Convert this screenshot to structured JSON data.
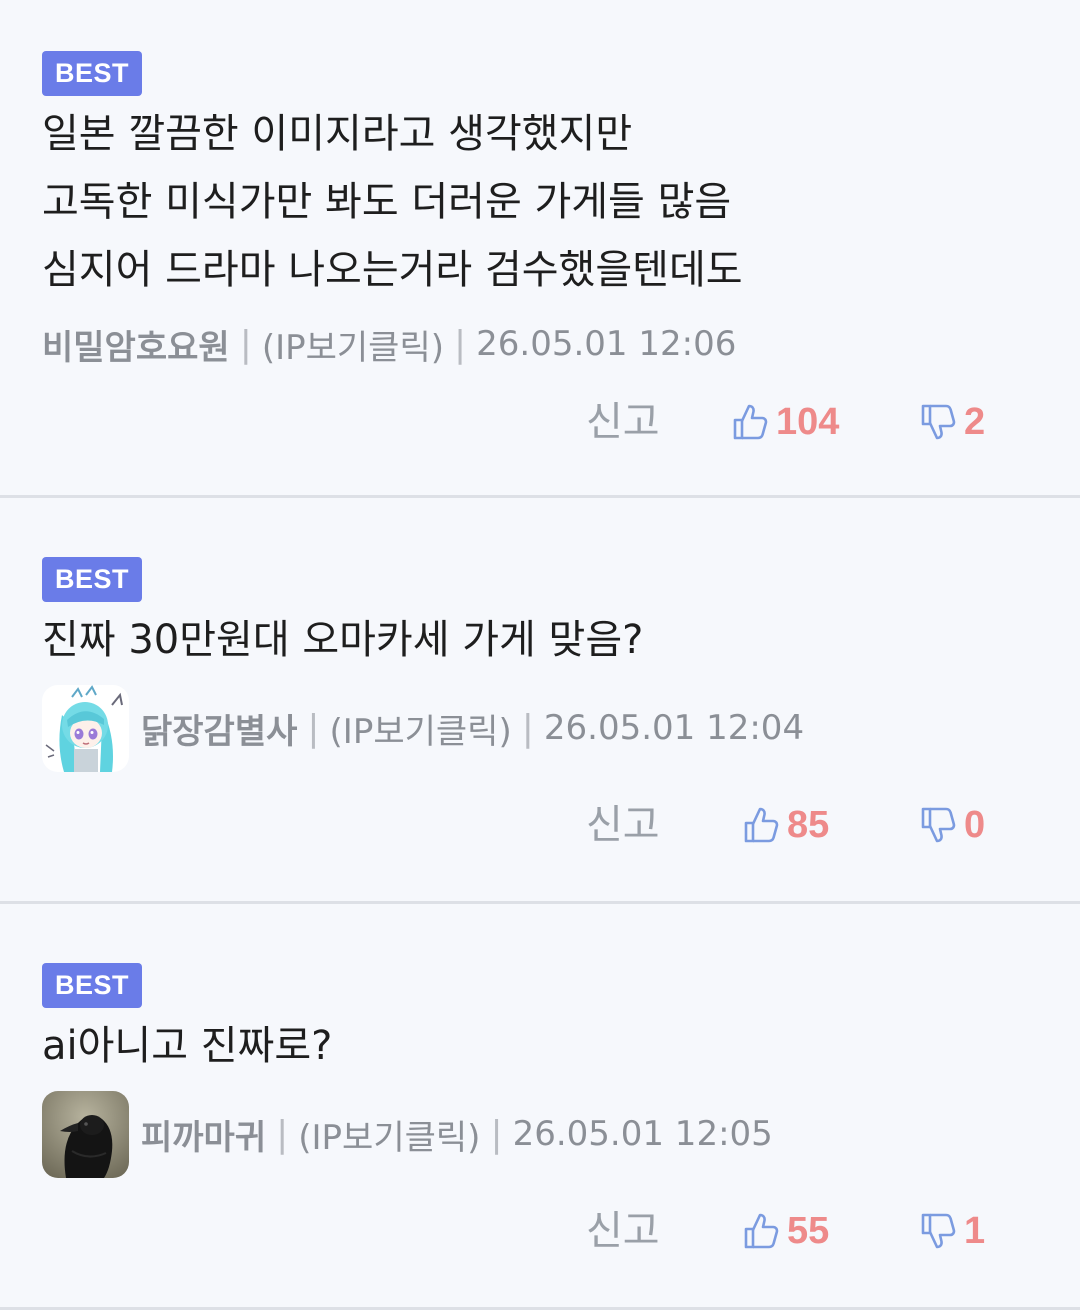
{
  "comments": [
    {
      "badge": "BEST",
      "lines": [
        "일본 깔끔한 이미지라고 생각했지만",
        "고독한 미식가만 봐도 더러운 가게들 많음",
        "심지어 드라마 나오는거라 검수했을텐데도"
      ],
      "nickname": "비밀암호요원",
      "ip": "(IP보기클릭)",
      "date": "26.05.01 12:06",
      "report": "신고",
      "likes": "104",
      "dislikes": "2"
    },
    {
      "badge": "BEST",
      "lines": [
        "진짜 30만원대 오마카세 가게 맞음?"
      ],
      "nickname": "닭장감별사",
      "ip": "(IP보기클릭)",
      "date": "26.05.01 12:04",
      "report": "신고",
      "likes": "85",
      "dislikes": "0",
      "avatar": "anime-character-avatar"
    },
    {
      "badge": "BEST",
      "lines": [
        "ai아니고 진짜로?"
      ],
      "nickname": "피까마귀",
      "ip": "(IP보기클릭)",
      "date": "26.05.01 12:05",
      "report": "신고",
      "likes": "55",
      "dislikes": "1",
      "avatar": "crow-photo-avatar"
    }
  ],
  "separator": "|",
  "colors": {
    "background": "#f6f8fc",
    "badge": "#6a7ce8",
    "vote_count": "#ee8a8a",
    "thumb_icon": "#7b9be0",
    "meta_text": "#8b8f96"
  }
}
